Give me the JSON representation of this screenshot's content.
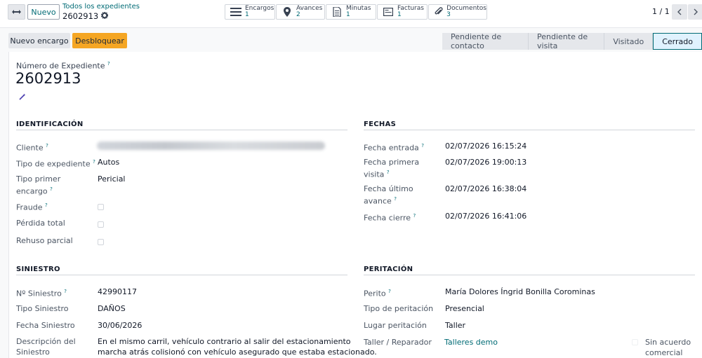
{
  "header": {
    "new_label": "Nuevo",
    "breadcrumb_parent": "Todos los expedientes",
    "breadcrumb_current": "2602913",
    "pager": "1 / 1"
  },
  "smart_buttons": [
    {
      "label": "Encargos",
      "count": "1",
      "icon": "list-icon"
    },
    {
      "label": "Avances",
      "count": "2",
      "icon": "map-pin-icon"
    },
    {
      "label": "Minutas",
      "count": "1",
      "icon": "document-icon"
    },
    {
      "label": "Facturas",
      "count": "1",
      "icon": "invoice-icon"
    },
    {
      "label": "Documentos",
      "count": "3",
      "icon": "paperclip-icon"
    }
  ],
  "actions": {
    "new_order": "Nuevo encargo",
    "unlock": "Desbloquear"
  },
  "stages": [
    "Pendiente de contacto",
    "Pendiente de visita",
    "Visitado",
    "Cerrado"
  ],
  "active_stage": "Cerrado",
  "record": {
    "number_label": "Número de Expediente",
    "number": "2602913"
  },
  "identificacion": {
    "title": "IDENTIFICACIÓN",
    "cliente_label": "Cliente",
    "tipo_expediente_label": "Tipo de expediente",
    "tipo_expediente": "Autos",
    "tipo_primer_encargo_label_1": "Tipo primer",
    "tipo_primer_encargo_label_2": "encargo",
    "tipo_primer_encargo": "Pericial",
    "fraude_label": "Fraude",
    "perdida_total_label": "Pérdida total",
    "rehuso_parcial_label": "Rehuso parcial"
  },
  "fechas": {
    "title": "FECHAS",
    "entrada_label": "Fecha entrada",
    "entrada": "02/07/2026 16:15:24",
    "primera_visita_label_1": "Fecha primera",
    "primera_visita_label_2": "visita",
    "primera_visita": "02/07/2026 19:00:13",
    "ultimo_avance_label_1": "Fecha último",
    "ultimo_avance_label_2": "avance",
    "ultimo_avance": "02/07/2026 16:38:04",
    "cierre_label": "Fecha cierre",
    "cierre": "02/07/2026 16:41:06"
  },
  "siniestro": {
    "title": "SINIESTRO",
    "numero_label": "Nº Siniestro",
    "numero": "42990117",
    "tipo_label": "Tipo Siniestro",
    "tipo": "DAÑOS",
    "fecha_label": "Fecha Siniestro",
    "fecha": "30/06/2026",
    "descripcion_label_1": "Descripción del",
    "descripcion_label_2": "Siniestro",
    "descripcion_1": "En el mismo carril, vehículo contrario al salir del estacionamiento",
    "descripcion_2": "marcha atrás colisionó con vehículo asegurado que estaba estacionado."
  },
  "peritacion": {
    "title": "PERITACIÓN",
    "perito_label": "Perito",
    "perito": "María Dolores Íngrid Bonilla Corominas",
    "tipo_label": "Tipo de peritación",
    "tipo": "Presencial",
    "lugar_label": "Lugar peritación",
    "lugar": "Taller",
    "taller_label": "Taller / Reparador",
    "taller": "Talleres demo",
    "sin_acuerdo_1": "Sin acuerdo",
    "sin_acuerdo_2": "comercial"
  },
  "colors": {
    "accent": "#016b75",
    "warning": "#f5a623"
  }
}
